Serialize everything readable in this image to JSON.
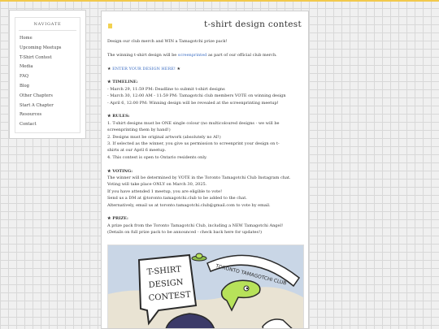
{
  "sidebar": {
    "heading": "NAVIGATE",
    "items": [
      {
        "label": "Home"
      },
      {
        "label": "Upcoming Meetups"
      },
      {
        "label": "T-Shirt Contest"
      },
      {
        "label": "Media"
      },
      {
        "label": "FAQ"
      },
      {
        "label": "Blog"
      },
      {
        "label": "Other Chapters"
      },
      {
        "label": "Start A Chapter"
      },
      {
        "label": "Resources"
      },
      {
        "label": "Contact"
      }
    ]
  },
  "page": {
    "title": "t-shirt design contest",
    "intro": "Design our club merch and WIN a Tamagotchi prize pack!",
    "winner_prefix": "The winning t-shirt design will be",
    "winner_link": "screenprinted",
    "winner_suffix": "as part of our official club merch.",
    "enter_star_left": "★",
    "enter_link": "ENTER YOUR DESIGN HERE!",
    "enter_star_right": "★",
    "timeline_heading": "★ TIMELINE:",
    "timeline": [
      "- March 29, 11:59 PM: Deadline to submit t-shirt designs",
      "- March 30, 12:00 AM - 11:59 PM: Tamagotchi club members VOTE on winning design",
      "- April 6, 12:00 PM: Winning design will be revealed at the screenprinting meetup!"
    ],
    "rules_heading": "★ RULES:",
    "rules": [
      "1. T-shirt designs must be ONE single colour (no multicoloured designs - we will be",
      "screenprinting them by hand!)",
      "2. Designs must be original artwork (absolutely no AI!)",
      "3. If selected as the winner, you give us permission to screenprint your design on t-",
      "shirts at our April 6 meetup.",
      "4. This contest is open to Ontario residents only."
    ],
    "voting_heading": "★ VOTING:",
    "voting": [
      "The winner will be determined by VOTE in the Toronto Tamagotchi Club Instagram chat.",
      "Voting will take place ONLY on March 30, 2025.",
      "If you have attended 1 meetup, you are eligible to vote!",
      "Send us a DM at @toronto.tamagotchi.club to be added to the chat.",
      "Alternatively, email us at toronto.tamagotchi.club@gmail.com to vote by email."
    ],
    "prize_heading": "★ PRIZE:",
    "prize": [
      "A prize pack from the Toronto Tamagotchi Club, including a NEW Tamagotchi Angel!",
      "(Details on full prize pack to be announced - check back here for updates!)"
    ],
    "poster": {
      "bubble_text": "T-SHIRT DESIGN CONTEST",
      "banner_text": "TORONTO TAMAGOTCHI CLUB",
      "colors": {
        "sky": "#c9d6e6",
        "bubble": "#ffffff",
        "ink": "#2a2a2a",
        "alien": "#b7e25a"
      }
    }
  },
  "colors": {
    "accent": "#f2c94c",
    "link": "#3a6cc2"
  }
}
